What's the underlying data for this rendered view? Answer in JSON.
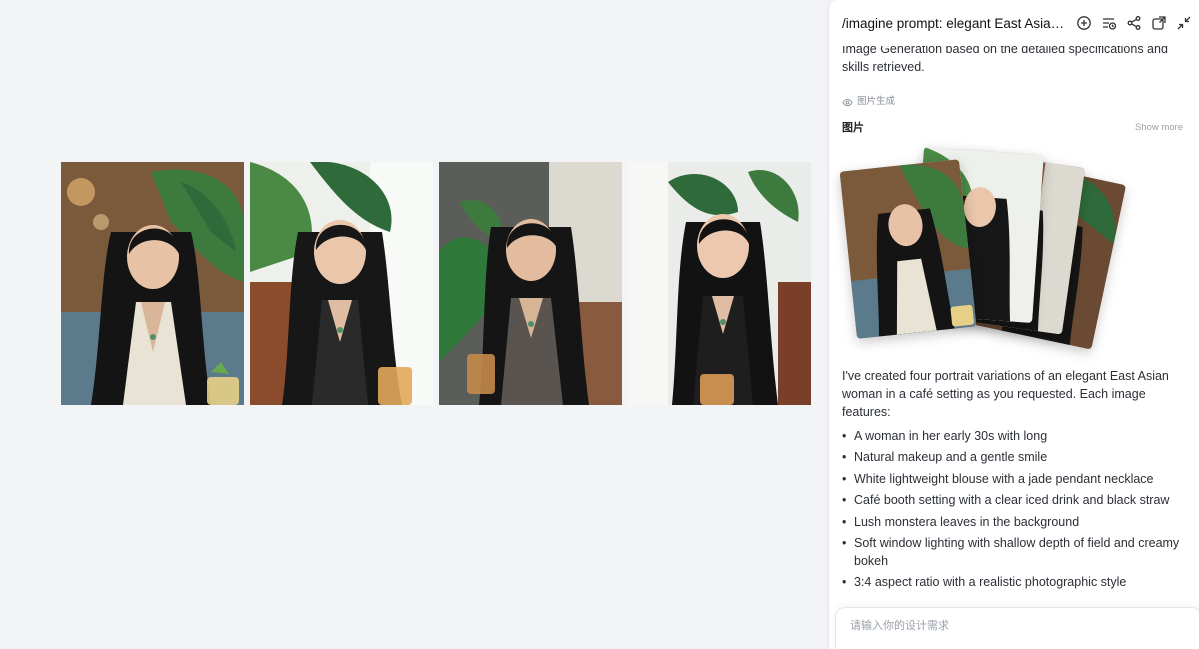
{
  "gallery": {
    "images": [
      {
        "name": "portrait-1"
      },
      {
        "name": "portrait-2"
      },
      {
        "name": "portrait-3"
      },
      {
        "name": "portrait-4"
      }
    ]
  },
  "panel": {
    "title": "/imagine prompt: elegant East Asian woman in café",
    "header_icons": [
      "add-circle-icon",
      "history-icon",
      "share-icon",
      "open-window-icon",
      "collapse-icon"
    ],
    "intro": "Image Generation based on the detailed specifications and skills retrieved.",
    "tool_label": "图片生成",
    "images_label": "图片",
    "show_more": "Show more",
    "summary": "I've created four portrait variations of an elegant East Asian woman in a café setting as you requested. Each image features:",
    "features": [
      "A woman in her early 30s with long",
      "Natural makeup and a gentle smile",
      "White lightweight blouse with a jade pendant necklace",
      "Café booth setting with a clear iced drink and black straw",
      "Lush monstera leaves in the background",
      "Soft window lighting with shallow depth of field and creamy bokeh",
      "3:4 aspect ratio with a realistic photographic style"
    ],
    "composer_placeholder": "请输入你的设计需求"
  },
  "colors": {
    "page_bg": "#f3f4f6",
    "panel_bg": "#ffffff",
    "muted_text": "#9aa0a8",
    "leaf_green": "#2f6b3a"
  }
}
